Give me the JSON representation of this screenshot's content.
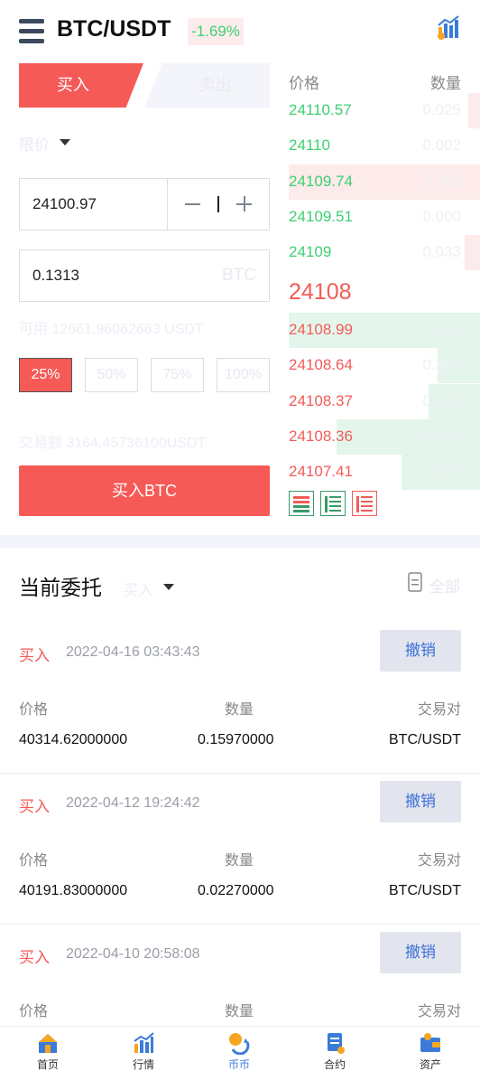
{
  "header": {
    "menu_icon": "hamburger-menu-icon",
    "pair": "BTC/USDT",
    "change": "-1.69%",
    "chart_icon": "kline-chart-icon"
  },
  "trade": {
    "tab_buy": "买入",
    "tab_sell": "卖出",
    "order_type": "限价",
    "price": "24100.97",
    "amount": "0.1313",
    "amount_unit": "BTC",
    "available": "可用 12661.96062663 USDT",
    "percents": [
      "25%",
      "50%",
      "75%",
      "100%"
    ],
    "selected_percent": "25%",
    "trade_amount": "交易额 3164.45736100USDT",
    "buy_button": "买入BTC"
  },
  "orderbook": {
    "price_header": "价格",
    "qty_header": "数量",
    "asks": [
      {
        "price": "24110.57",
        "qty": "0.025",
        "depth": 0.06
      },
      {
        "price": "24110",
        "qty": "0.002",
        "depth": 0.0
      },
      {
        "price": "24109.74",
        "qty": "0.400",
        "depth": 1.0
      },
      {
        "price": "24109.51",
        "qty": "0.000",
        "depth": 0.0
      },
      {
        "price": "24109",
        "qty": "0.033",
        "depth": 0.08
      }
    ],
    "last_price": "24108",
    "bids": [
      {
        "price": "24108.99",
        "qty": "0.634",
        "depth": 1.0
      },
      {
        "price": "24108.64",
        "qty": "0.350",
        "depth": 0.22
      },
      {
        "price": "24108.37",
        "qty": "0.300",
        "depth": 0.27
      },
      {
        "price": "24108.36",
        "qty": "0.600",
        "depth": 0.75
      },
      {
        "price": "24107.41",
        "qty": "1.000",
        "depth": 0.41
      }
    ],
    "ask_color": "#3ecf72",
    "bid_color": "#f25c58"
  },
  "orders": {
    "title": "当前委托",
    "filter": "买入",
    "all_label": "全部",
    "col_price": "价格",
    "col_qty": "数量",
    "col_pair": "交易对",
    "cancel_label": "撤销",
    "items": [
      {
        "side": "买入",
        "time": "2022-04-16 03:43:43",
        "price": "40314.62000000",
        "qty": "0.15970000",
        "pair": "BTC/USDT"
      },
      {
        "side": "买入",
        "time": "2022-04-12 19:24:42",
        "price": "40191.83000000",
        "qty": "0.02270000",
        "pair": "BTC/USDT"
      },
      {
        "side": "买入",
        "time": "2022-04-10 20:58:08",
        "price": "",
        "qty": "",
        "pair": ""
      }
    ]
  },
  "nav": {
    "items": [
      {
        "label": "首页",
        "icon": "home-icon"
      },
      {
        "label": "行情",
        "icon": "market-chart-icon"
      },
      {
        "label": "币币",
        "icon": "coin-exchange-icon"
      },
      {
        "label": "合约",
        "icon": "contract-icon"
      },
      {
        "label": "资产",
        "icon": "wallet-icon"
      }
    ],
    "active": "币币"
  }
}
